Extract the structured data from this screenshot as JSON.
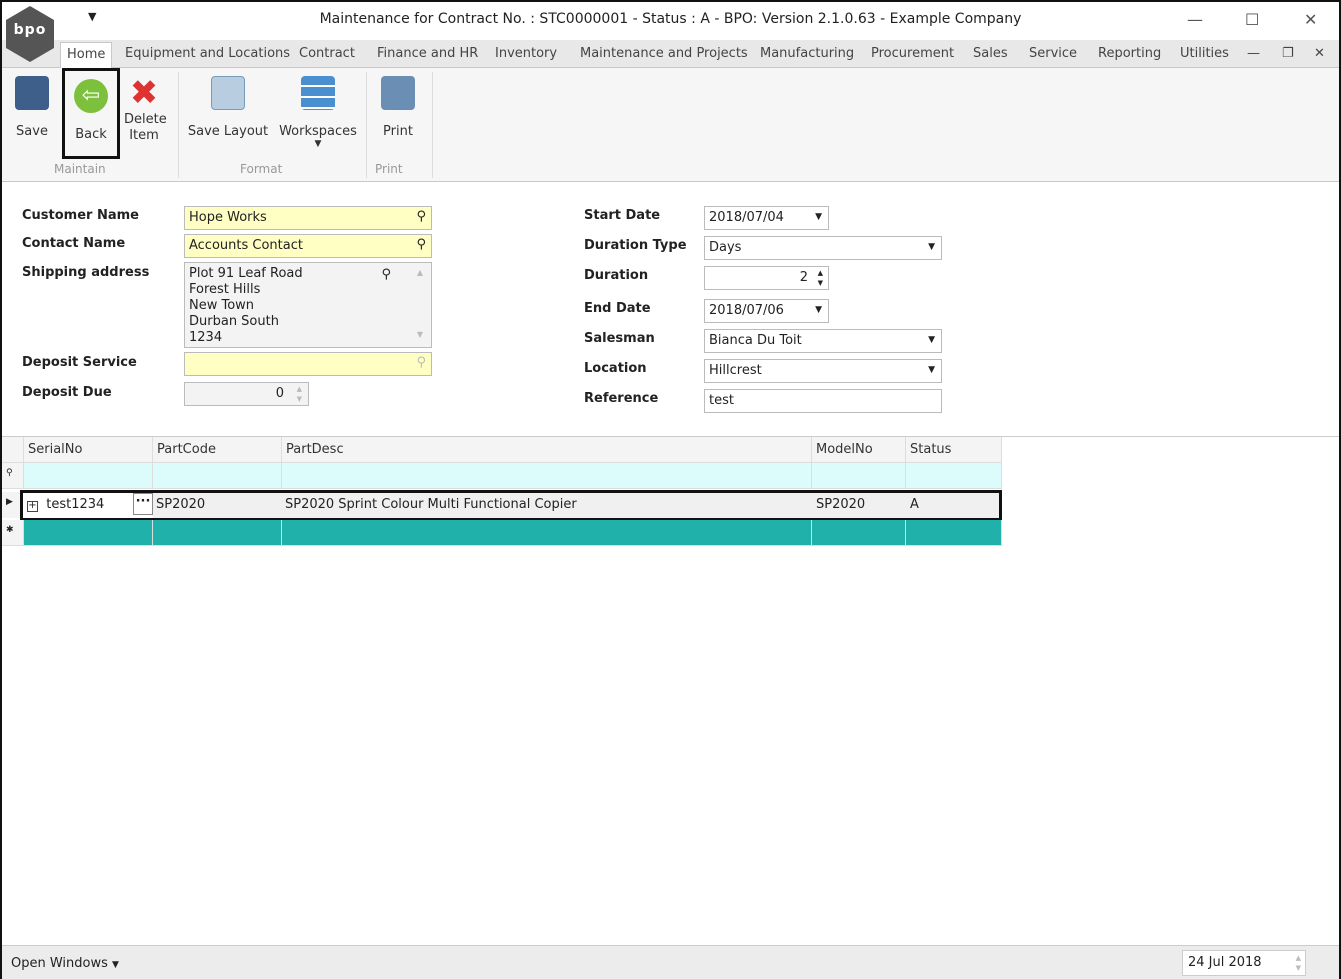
{
  "window": {
    "title": "Maintenance for Contract No. : STC0000001 - Status : A - BPO: Version 2.1.0.63 - Example Company",
    "logo_text": "bpo"
  },
  "tabs": [
    "Home",
    "Equipment and Locations",
    "Contract",
    "Finance and HR",
    "Inventory",
    "Maintenance and Projects",
    "Manufacturing",
    "Procurement",
    "Sales",
    "Service",
    "Reporting",
    "Utilities"
  ],
  "ribbon": {
    "save": "Save",
    "back": "Back",
    "delete": "Delete Item",
    "save_layout": "Save Layout",
    "workspaces": "Workspaces",
    "print": "Print",
    "groups": {
      "maintain": "Maintain",
      "format": "Format",
      "print": "Print"
    }
  },
  "form": {
    "customer_name": {
      "label": "Customer Name",
      "value": "Hope Works"
    },
    "contact_name": {
      "label": "Contact Name",
      "value": "Accounts Contact"
    },
    "shipping_address": {
      "label": "Shipping address",
      "lines": [
        "Plot 91 Leaf Road",
        "Forest Hills",
        "New Town",
        "Durban South",
        "1234"
      ]
    },
    "deposit_service": {
      "label": "Deposit Service",
      "value": ""
    },
    "deposit_due": {
      "label": "Deposit Due",
      "value": "0"
    },
    "start_date": {
      "label": "Start Date",
      "value": "2018/07/04"
    },
    "duration_type": {
      "label": "Duration Type",
      "value": "Days"
    },
    "duration": {
      "label": "Duration",
      "value": "2"
    },
    "end_date": {
      "label": "End Date",
      "value": "2018/07/06"
    },
    "salesman": {
      "label": "Salesman",
      "value": "Bianca Du Toit"
    },
    "location": {
      "label": "Location",
      "value": "Hillcrest"
    },
    "reference": {
      "label": "Reference",
      "value": "test"
    }
  },
  "grid": {
    "columns": [
      "SerialNo",
      "PartCode",
      "PartDesc",
      "ModelNo",
      "Status"
    ],
    "rows": [
      {
        "SerialNo": "test1234",
        "PartCode": "SP2020",
        "PartDesc": "SP2020 Sprint Colour Multi Functional Copier",
        "ModelNo": "SP2020",
        "Status": "A"
      }
    ]
  },
  "status": {
    "open_windows": "Open Windows",
    "date": "24 Jul 2018"
  },
  "colors": {
    "new_row": "#20b2aa",
    "filter_row": "#dcfcfc"
  }
}
